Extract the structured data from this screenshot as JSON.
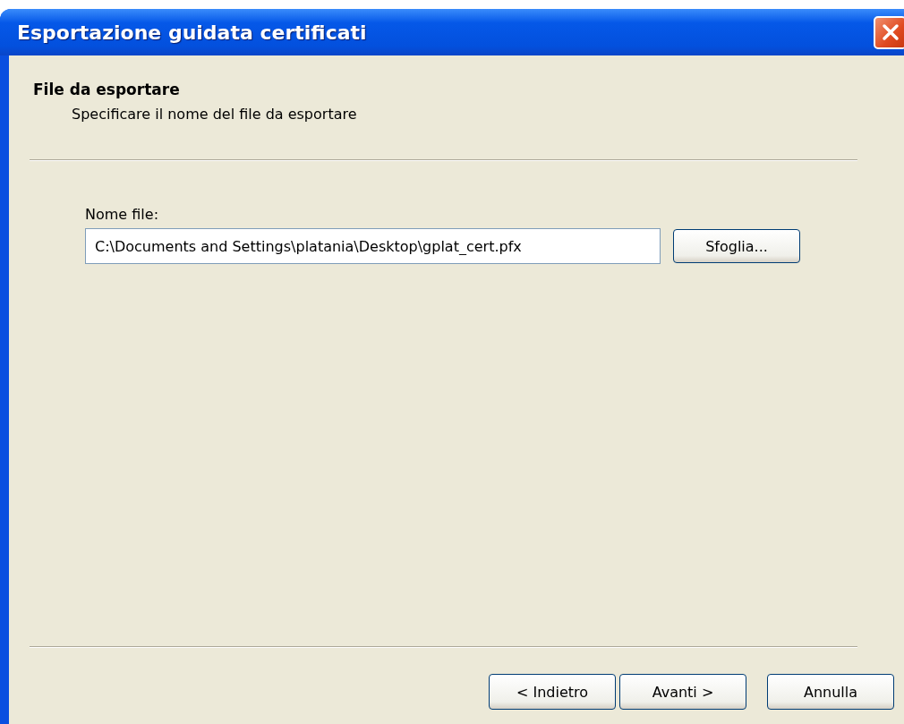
{
  "window": {
    "title": "Esportazione guidata certificati"
  },
  "header": {
    "title": "File da esportare",
    "subtitle": "Specificare il nome del file da esportare"
  },
  "file_name": {
    "label": "Nome file:",
    "value": "C:\\Documents and Settings\\platania\\Desktop\\gplat_cert.pfx",
    "browse_button": "Sfoglia..."
  },
  "buttons": [
    {
      "label": "< Indietro",
      "kind": "back"
    },
    {
      "label": "Avanti >",
      "kind": "next"
    },
    {
      "label": "Annulla",
      "kind": "cancel"
    }
  ]
}
